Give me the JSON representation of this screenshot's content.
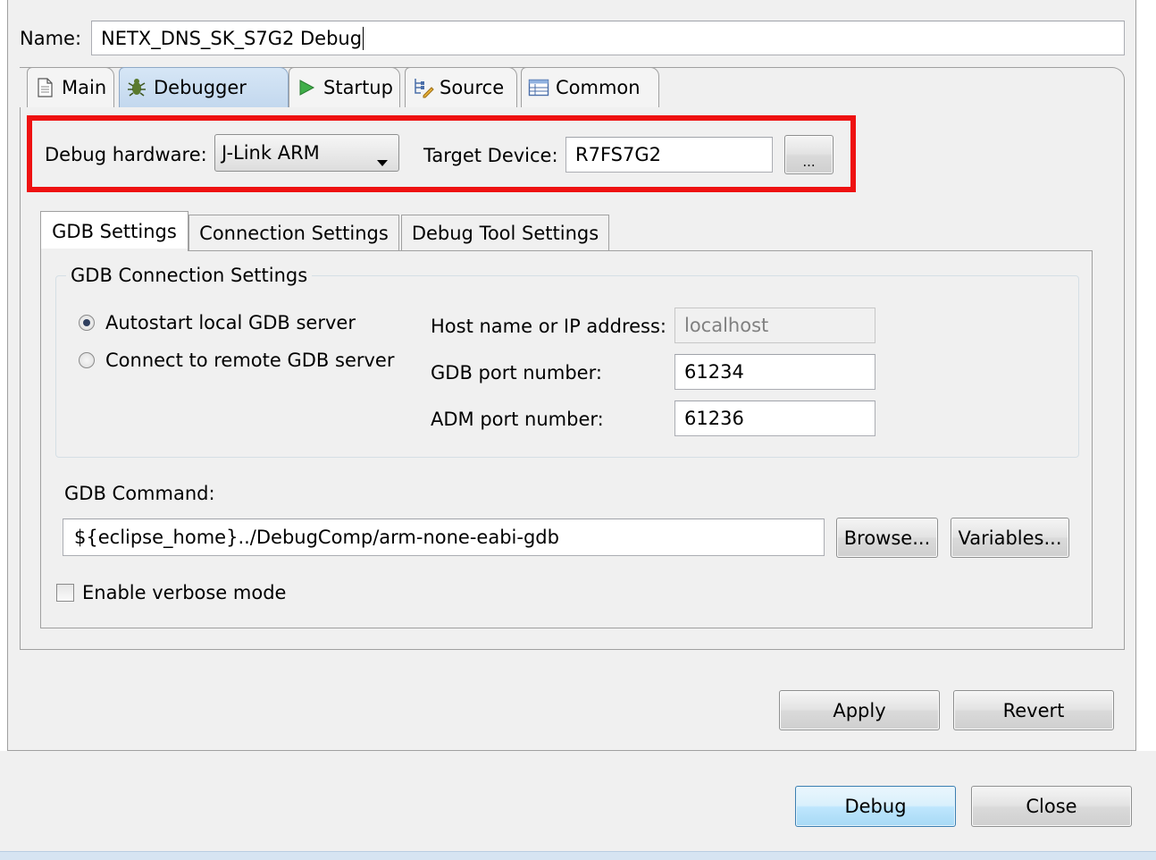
{
  "name_label": "Name:",
  "config_name": "NETX_DNS_SK_S7G2 Debug",
  "tabs": [
    {
      "label": "Main",
      "icon": "document-icon"
    },
    {
      "label": "Debugger",
      "icon": "bug-icon"
    },
    {
      "label": "Startup",
      "icon": "play-icon"
    },
    {
      "label": "Source",
      "icon": "source-tree-icon"
    },
    {
      "label": "Common",
      "icon": "table-icon"
    }
  ],
  "debug_hardware": {
    "label": "Debug hardware:",
    "value": "J-Link ARM"
  },
  "target_device": {
    "label": "Target Device:",
    "value": "R7FS7G2",
    "browse_label": "..."
  },
  "highlight_color": "#ee1111",
  "inner_tabs": [
    "GDB Settings",
    "Connection Settings",
    "Debug Tool Settings"
  ],
  "gdb_connection": {
    "group_title": "GDB Connection Settings",
    "autostart_label": "Autostart local GDB server",
    "remote_label": "Connect to remote GDB server",
    "selected": "autostart",
    "host_label": "Host name or IP address:",
    "host_value": "localhost",
    "gdb_port_label": "GDB port number:",
    "gdb_port_value": "61234",
    "adm_port_label": "ADM port number:",
    "adm_port_value": "61236"
  },
  "gdb_command": {
    "label": "GDB Command:",
    "value": "${eclipse_home}../DebugComp/arm-none-eabi-gdb",
    "browse_label": "Browse...",
    "variables_label": "Variables..."
  },
  "verbose": {
    "label": "Enable verbose mode",
    "checked": false
  },
  "apply_label": "Apply",
  "revert_label": "Revert",
  "debug_label": "Debug",
  "close_label": "Close"
}
